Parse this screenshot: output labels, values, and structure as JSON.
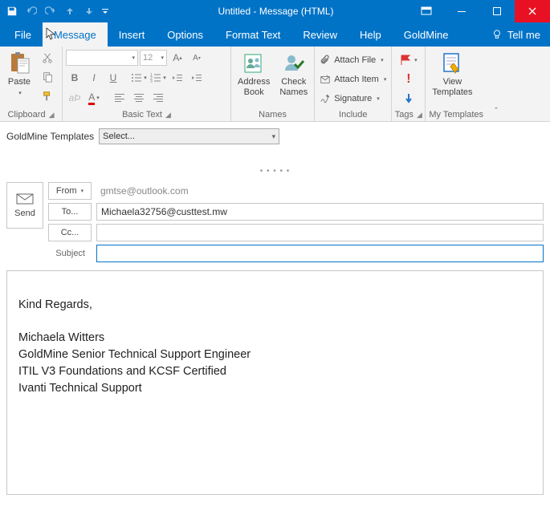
{
  "titlebar": {
    "title": "Untitled - Message (HTML)"
  },
  "tabs": {
    "file": "File",
    "message": "Message",
    "insert": "Insert",
    "options": "Options",
    "format_text": "Format Text",
    "review": "Review",
    "help": "Help",
    "goldmine": "GoldMine",
    "tell_me": "Tell me"
  },
  "ribbon": {
    "clipboard": {
      "title": "Clipboard",
      "paste": "Paste"
    },
    "basic_text": {
      "title": "Basic Text",
      "font_name": "",
      "font_size": "12"
    },
    "names": {
      "title": "Names",
      "address_book": "Address\nBook",
      "check_names": "Check\nNames"
    },
    "include": {
      "title": "Include",
      "attach_file": "Attach File",
      "attach_item": "Attach Item",
      "signature": "Signature"
    },
    "tags": {
      "title": "Tags"
    },
    "templates": {
      "title": "My Templates",
      "view_templates": "View\nTemplates"
    }
  },
  "gm": {
    "label": "GoldMine Templates",
    "select": "Select..."
  },
  "envelope": {
    "send": "Send",
    "from_label": "From",
    "from_value": "gmtse@outlook.com",
    "to_label": "To...",
    "to_value": "Michaela32756@custtest.mw",
    "cc_label": "Cc...",
    "cc_value": "",
    "subject_label": "Subject",
    "subject_value": ""
  },
  "body": {
    "l1": "Kind Regards,",
    "l2": "Michaela Witters",
    "l3": "GoldMine Senior Technical Support Engineer",
    "l4": "ITIL V3 Foundations and KCSF Certified",
    "l5": "Ivanti Technical Support"
  }
}
